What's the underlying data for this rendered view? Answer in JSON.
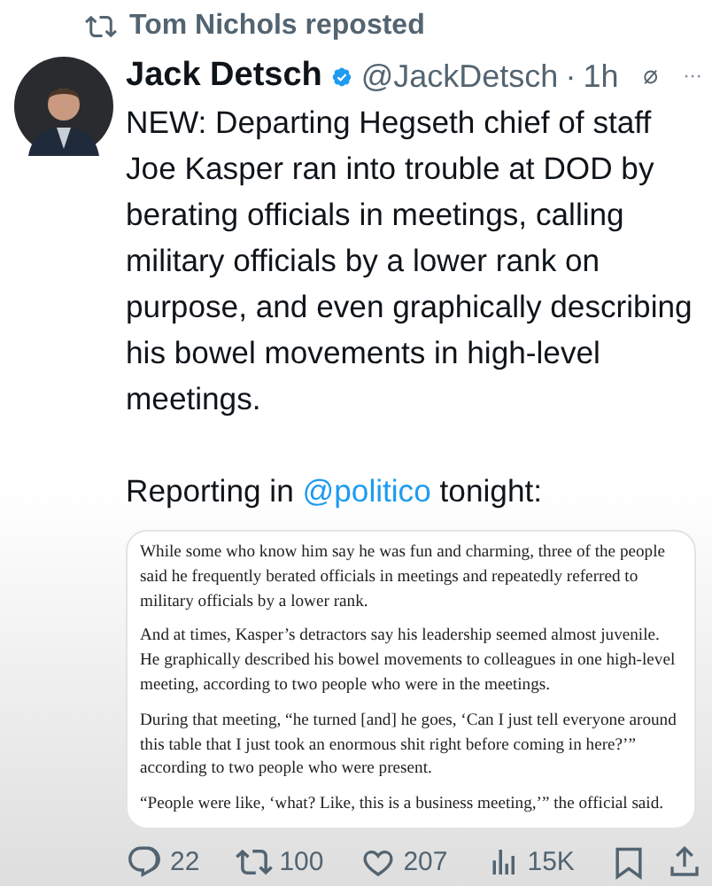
{
  "repost": {
    "text": "Tom Nichols reposted"
  },
  "author": {
    "name": "Jack Detsch",
    "verified": true,
    "handle": "@JackDetsch",
    "separator": "·",
    "time": "1h"
  },
  "post": {
    "text": "NEW: Departing Hegseth chief of staff Joe Kasper ran into trouble at DOD by berating officials in meetings, calling military officials by a lower rank on purpose, and even graphically describing his bowel movements in high-level meetings.",
    "before_link": "Reporting in ",
    "link": "@politico",
    "after_link": " tonight:"
  },
  "quote_card": {
    "paragraphs": [
      "While some who know him say he was fun and charming, three of the people said he frequently berated officials in meetings and repeatedly referred to military officials by a lower rank.",
      "And at times, Kasper’s detractors say his leadership seemed almost juvenile. He graphically described his bowel movements to colleagues in one high-level meeting, according to two people who were in the meetings.",
      "During that meeting, “he turned [and] he goes, ‘Can I just tell everyone around this table that I just took an enormous shit right before coming in here?’” according to two people who were present.",
      "“People were like, ‘what? Like, this is a business meeting,’” the official said."
    ]
  },
  "actions": [
    {
      "kind": "reply",
      "count": "22"
    },
    {
      "kind": "repost",
      "count": "100"
    },
    {
      "kind": "like",
      "count": "207"
    },
    {
      "kind": "views",
      "count": "15K"
    },
    {
      "kind": "bookmark"
    },
    {
      "kind": "share"
    }
  ]
}
